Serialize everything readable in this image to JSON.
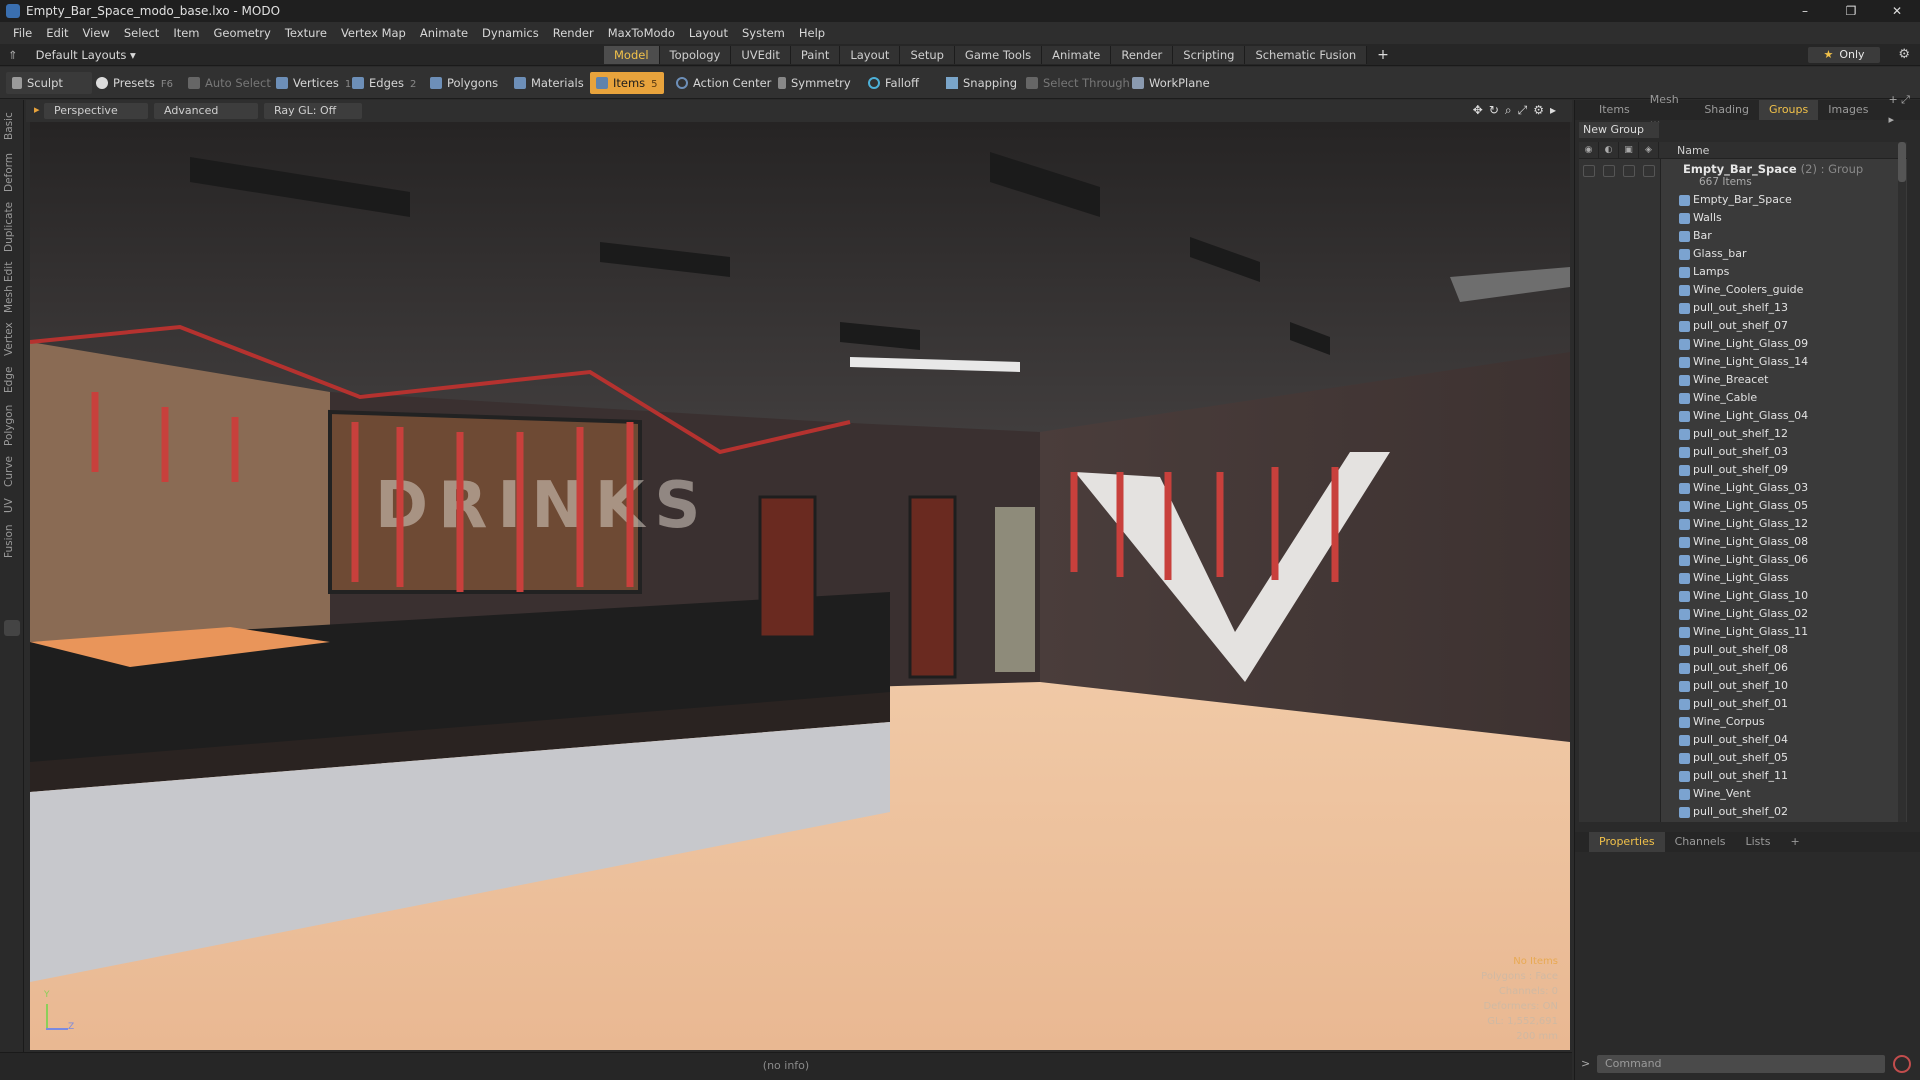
{
  "window": {
    "title": "Empty_Bar_Space_modo_base.lxo - MODO",
    "controls": [
      "–",
      "❐",
      "✕"
    ]
  },
  "menu": [
    "File",
    "Edit",
    "View",
    "Select",
    "Item",
    "Geometry",
    "Texture",
    "Vertex Map",
    "Animate",
    "Dynamics",
    "Render",
    "MaxToModo",
    "Layout",
    "System",
    "Help"
  ],
  "layoutbar": {
    "layout_label": "Default Layouts ▾",
    "tabs": [
      "Model",
      "Topology",
      "UVEdit",
      "Paint",
      "Layout",
      "Setup",
      "Game Tools",
      "Animate",
      "Render",
      "Scripting",
      "Schematic Fusion"
    ],
    "active_tab": "Model",
    "only_label": "Only"
  },
  "toolbar": {
    "sculpt": "Sculpt",
    "presets": "Presets",
    "presets_key": "F6",
    "auto_select": "Auto Select",
    "vertices": "Vertices",
    "vertices_key": "1",
    "edges": "Edges",
    "edges_key": "2",
    "polygons": "Polygons",
    "materials": "Materials",
    "items": "Items",
    "items_key": "5",
    "action_center": "Action Center",
    "symmetry": "Symmetry",
    "falloff": "Falloff",
    "snapping": "Snapping",
    "select_through": "Select Through",
    "workplane": "WorkPlane"
  },
  "left_tabs": [
    "Basic",
    "Deform",
    "Duplicate",
    "Mesh Edit",
    "Vertex",
    "Edge",
    "Polygon",
    "Curve",
    "UV",
    "Fusion"
  ],
  "viewport": {
    "view_label": "Perspective",
    "shading_label": "Advanced",
    "raygl_label": "Ray GL: Off",
    "sign_text": "DRINKS",
    "info": [
      "No Items",
      "Polygons : Face",
      "Channels: 0",
      "Deformers: ON",
      "GL: 1,552,691",
      "200 mm"
    ],
    "axis": {
      "y": "Y",
      "z": "Z"
    }
  },
  "status": "(no info)",
  "right_panel": {
    "tabs": [
      "Items",
      "Mesh ...",
      "Shading",
      "Groups",
      "Images"
    ],
    "active_tab": "Groups",
    "new_group": "New Group",
    "column_name": "Name",
    "group_name": "Empty_Bar_Space",
    "group_suffix": "(2) : Group",
    "group_count": "667 Items",
    "items": [
      "Empty_Bar_Space",
      "Walls",
      "Bar",
      "Glass_bar",
      "Lamps",
      "Wine_Coolers_guide",
      "pull_out_shelf_13",
      "pull_out_shelf_07",
      "Wine_Light_Glass_09",
      "Wine_Light_Glass_14",
      "Wine_Breacet",
      "Wine_Cable",
      "Wine_Light_Glass_04",
      "pull_out_shelf_12",
      "pull_out_shelf_03",
      "pull_out_shelf_09",
      "Wine_Light_Glass_03",
      "Wine_Light_Glass_05",
      "Wine_Light_Glass_12",
      "Wine_Light_Glass_08",
      "Wine_Light_Glass_06",
      "Wine_Light_Glass",
      "Wine_Light_Glass_10",
      "Wine_Light_Glass_02",
      "Wine_Light_Glass_11",
      "pull_out_shelf_08",
      "pull_out_shelf_06",
      "pull_out_shelf_10",
      "pull_out_shelf_01",
      "Wine_Corpus",
      "pull_out_shelf_04",
      "pull_out_shelf_05",
      "pull_out_shelf_11",
      "Wine_Vent",
      "pull_out_shelf_02"
    ],
    "bottom_tabs": [
      "Properties",
      "Channels",
      "Lists"
    ],
    "bottom_active": "Properties",
    "command_placeholder": "Command"
  }
}
